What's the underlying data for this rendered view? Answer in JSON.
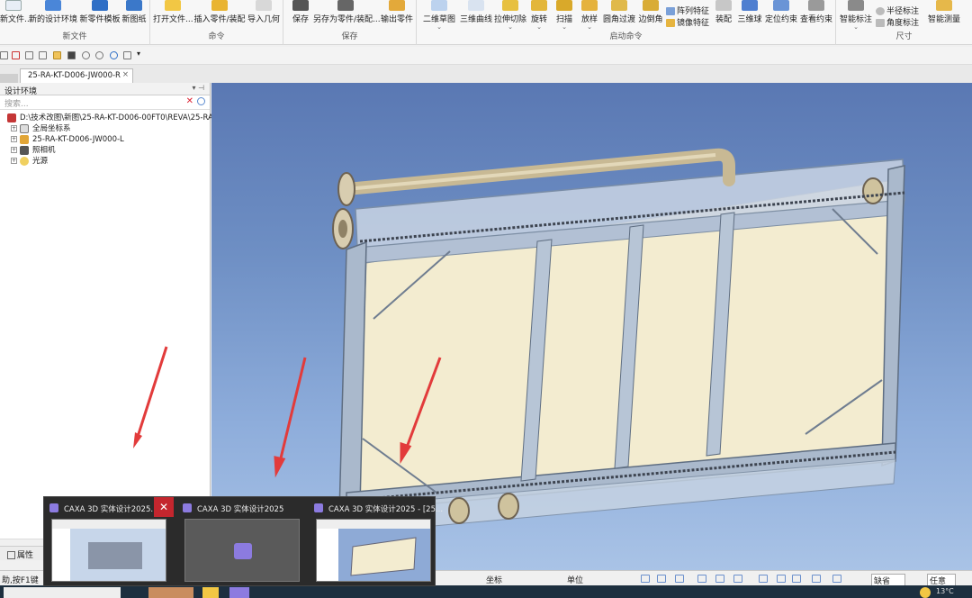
{
  "ribbon": {
    "groups": [
      {
        "name": "新文件",
        "buttons": [
          "新文件...",
          "新的设计环境",
          "新零件模板",
          "新图纸"
        ]
      },
      {
        "name": "命令",
        "buttons": [
          "打开文件...",
          "插入零件/装配",
          "导入几何"
        ]
      },
      {
        "name": "保存",
        "buttons": [
          "保存",
          "另存为零件/装配...",
          "输出零件"
        ]
      },
      {
        "name": "启动命令",
        "buttons": [
          "二维草图",
          "三维曲线",
          "拉伸切除",
          "旋转",
          "扫描",
          "放样",
          "圆角过渡",
          "边倒角"
        ],
        "small": [
          "阵列特征",
          "镜像特征"
        ],
        "buttons2": [
          "装配",
          "三维球",
          "定位约束",
          "查看约束"
        ]
      },
      {
        "name": "尺寸",
        "buttons": [
          "智能标注"
        ],
        "small": [
          "半径标注",
          "角度标注"
        ],
        "buttons2": [
          "智能测量"
        ]
      }
    ]
  },
  "doc_tab": {
    "title": "25-RA-KT-D006-JW000-R",
    "close": "×"
  },
  "left_panel": {
    "title": "设计环境",
    "pin": "▾ ⊣",
    "search_placeholder": "搜索...",
    "tree": [
      {
        "label": "D:\\技术改图\\新图\\25-RA-KT-D006-00FT0\\REVA\\25-RA",
        "level": 0
      },
      {
        "label": "全局坐标系",
        "level": 1
      },
      {
        "label": "25-RA-KT-D006-JW000-L",
        "level": 1
      },
      {
        "label": "照相机",
        "level": 1
      },
      {
        "label": "光源",
        "level": 1
      }
    ],
    "bottom_tab": "属性"
  },
  "status_bar": {
    "help": "助,按F1键",
    "coord": "坐标",
    "unit": "单位",
    "filter_default": "缺省",
    "filter_any": "任意"
  },
  "thumbnails": [
    {
      "title": "CAXA 3D 实体设计2025..."
    },
    {
      "title": "CAXA 3D 实体设计2025"
    },
    {
      "title": "CAXA 3D 实体设计2025 - [25..."
    }
  ],
  "taskbar": {
    "temp": "13°C"
  },
  "colors": {
    "viewport_top": "#5a78b3",
    "viewport_bottom": "#a9c3e6",
    "panel_fill": "#f3ecd0",
    "frame": "#7d8ea3",
    "arrow": "#e23b3b"
  }
}
